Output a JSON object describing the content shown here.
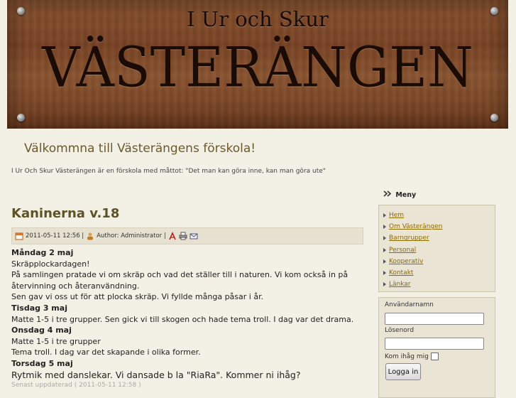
{
  "banner": {
    "subtitle": "I Ur och Skur",
    "title": "VÄSTERÄNGEN"
  },
  "welcome": "Välkommna till Västerängens förskola!",
  "tagline": "I Ur Och Skur Västerängen är en förskola med måttot: \"Det man kan göra inne, kan man göra ute\"",
  "article": {
    "title": "Kaninerna v.18",
    "meta": {
      "date": "2011-05-11 12:56 |",
      "author": "Author: Administrator |",
      "icons": [
        "calendar-icon",
        "author-icon",
        "pdf-icon",
        "print-icon",
        "email-icon"
      ]
    },
    "lines": [
      {
        "text": "Måndag 2 maj",
        "bold": true
      },
      {
        "text": "Skräpplockardagen!"
      },
      {
        "text": "På samlingen pratade vi om skräp och vad det ställer till i naturen. Vi kom också in på"
      },
      {
        "text": "återvinning och återanvändning."
      },
      {
        "text": "Sen gav vi oss ut för att plocka skräp. Vi fyllde många påsar i år."
      },
      {
        "text": "Tisdag 3 maj",
        "bold": true
      },
      {
        "text": "Matte 1-5 i tre grupper. Sen gick vi till skogen och hade tema troll. I dag var det drama."
      },
      {
        "text": "Onsdag 4 maj",
        "bold": true
      },
      {
        "text": "Matte 1-5 i tre grupper"
      },
      {
        "text": "Tema troll. I dag var det skapande i olika former."
      },
      {
        "text": "Torsdag 5 maj",
        "bold": true
      },
      {
        "text": "Rytmik med danslekar. Vi dansade b la \"RiaRa\". Kommer ni ihåg?",
        "big": true
      }
    ],
    "updated": "Senast uppdaterad ( 2011-05-11 12:58 )"
  },
  "menu": {
    "heading": "Meny",
    "items": [
      "Hem",
      "Om Västerängen",
      "Barngrupper",
      "Personal",
      "Kooperativ",
      "Kontakt",
      "Länkar"
    ]
  },
  "login": {
    "username_label": "Användarnamn",
    "password_label": "Lösenord",
    "remember_label": "Kom ihåg mig",
    "button": "Logga in"
  }
}
